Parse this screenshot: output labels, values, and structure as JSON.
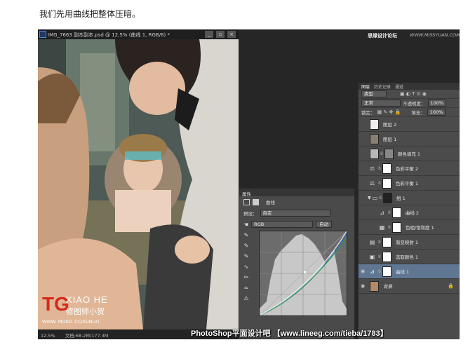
{
  "intro_text": "我们先用曲线把整体压暗。",
  "doc": {
    "title": "IMG_7663 副本副本.psd @ 12.5% (曲线 1, RGB/8) *",
    "window_buttons": [
      "_",
      "▫",
      "×"
    ],
    "zoom": "12.5%",
    "doc_size": "文档:68.2M/177.3M"
  },
  "credit": {
    "site": "思缘设计论坛",
    "url": "WWW.MISSYUAN.COM"
  },
  "properties": {
    "tab": "属性",
    "adjustment_name": "曲线",
    "preset_label": "预设：",
    "preset_value": "自定",
    "channel_value": "RGB",
    "auto_button": "自动"
  },
  "layers_panel": {
    "tabs": [
      "图层",
      "历史记录",
      "通道"
    ],
    "filter_label": "类型",
    "blend_mode": "正常",
    "opacity_label": "不透明度：",
    "opacity_value": "100%",
    "lock_label": "锁定：",
    "fill_label": "填充：",
    "fill_value": "100%",
    "layers": [
      {
        "name": "图层 2",
        "type": "pixel",
        "indent": 0,
        "visible": false,
        "selected": false
      },
      {
        "name": "图层 1",
        "type": "pixel",
        "indent": 0,
        "visible": false,
        "selected": false
      },
      {
        "name": "颜色填充 1",
        "type": "fill",
        "indent": 0,
        "visible": false,
        "selected": false
      },
      {
        "name": "色彩平衡 2",
        "type": "adjustment",
        "indent": 0,
        "visible": false,
        "selected": false
      },
      {
        "name": "色彩平衡 1",
        "type": "adjustment",
        "indent": 0,
        "visible": false,
        "selected": false
      },
      {
        "name": "组 1",
        "type": "group",
        "indent": 0,
        "visible": false,
        "selected": false
      },
      {
        "name": "曲线 2",
        "type": "adjustment",
        "indent": 1,
        "visible": false,
        "selected": false
      },
      {
        "name": "色相/饱和度 1",
        "type": "adjustment",
        "indent": 1,
        "visible": false,
        "selected": false
      },
      {
        "name": "渐变映射 1",
        "type": "adjustment",
        "indent": 0,
        "visible": false,
        "selected": false
      },
      {
        "name": "选取颜色 1",
        "type": "adjustment",
        "indent": 0,
        "visible": false,
        "selected": false
      },
      {
        "name": "曲线 1",
        "type": "adjustment",
        "indent": 0,
        "visible": true,
        "selected": true
      },
      {
        "name": "背景",
        "type": "background",
        "indent": 0,
        "visible": true,
        "selected": false
      }
    ]
  },
  "watermark": {
    "logo": "TG",
    "name_en": "XIAO HE",
    "name_cn": "修图师小贺",
    "url": "WWW. MOKO. CC/XUNUO",
    "bottom": "PhotoShop平面设计吧 【www.lineeg.com/tieba/1783】"
  }
}
